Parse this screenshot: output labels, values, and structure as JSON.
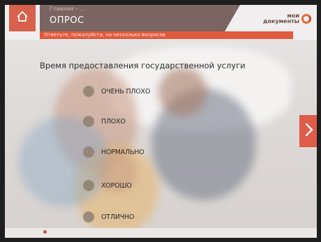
{
  "header": {
    "breadcrumb": "Главная › ...",
    "title": "ОПРОС",
    "subtitle": "Ответьте, пожалуйста, на несколько вопросов",
    "logo_line1": "мои",
    "logo_line2": "документы"
  },
  "question": {
    "text": "Время предоставления государственной услуги",
    "options": [
      {
        "label": "ОЧЕНЬ ПЛОХО"
      },
      {
        "label": "ПЛОХО"
      },
      {
        "label": "НОРМАЛЬНО"
      },
      {
        "label": "ХОРОШО"
      },
      {
        "label": "ОТЛИЧНО"
      }
    ]
  },
  "colors": {
    "accent": "#e05a3e",
    "title_block": "#7a6562",
    "home_button": "#d7614d"
  },
  "icons": {
    "home": "home-icon",
    "next": "chevron-right-icon",
    "logo": "logo-mark-icon"
  }
}
